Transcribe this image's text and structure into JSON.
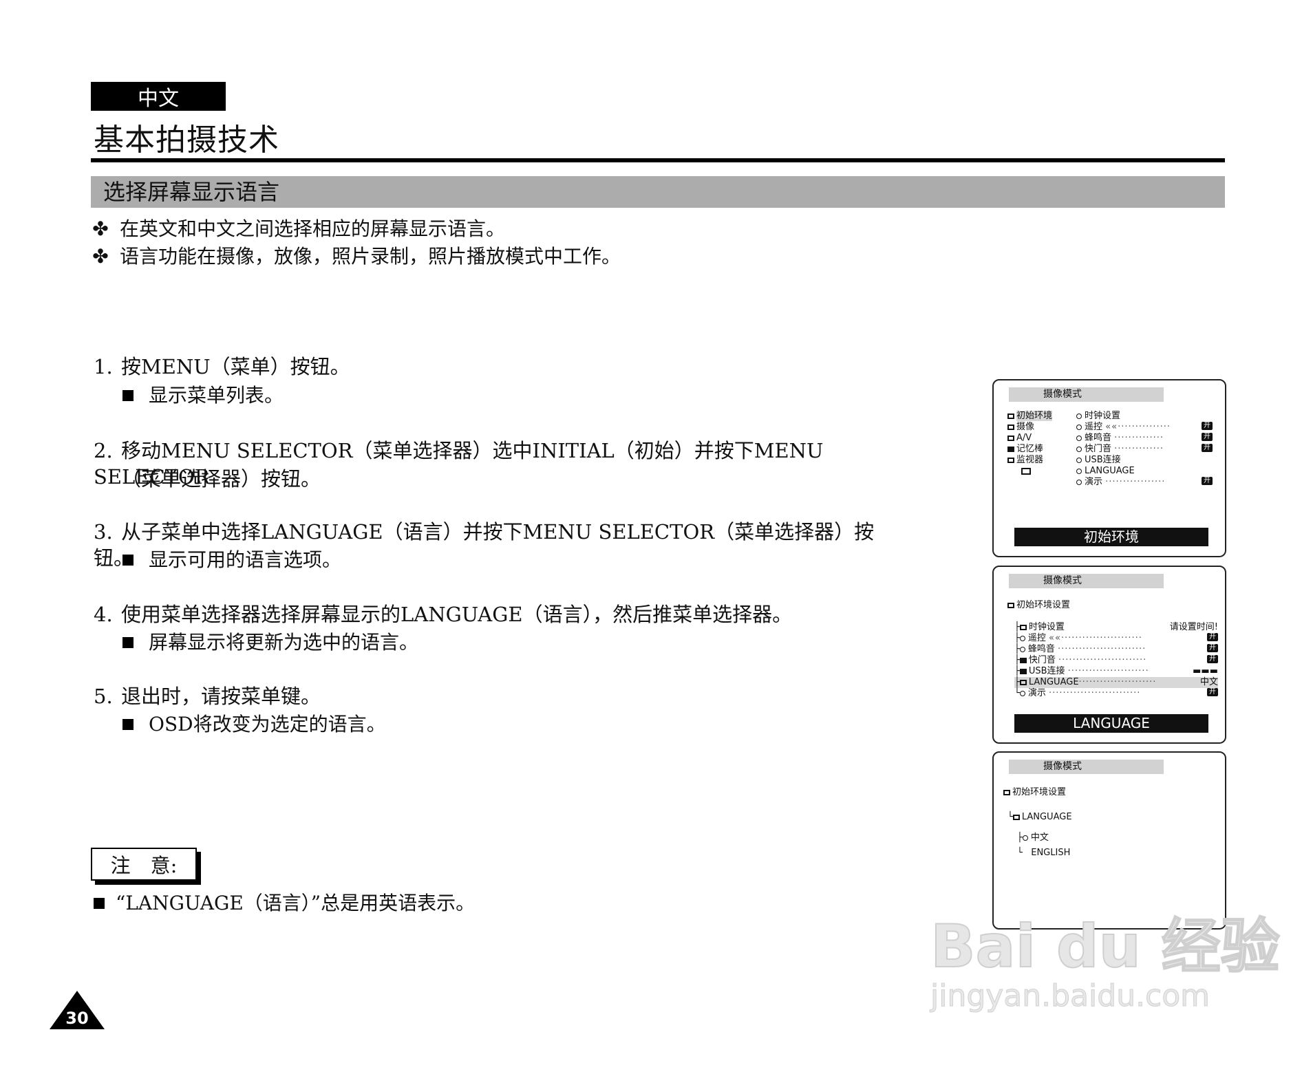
{
  "header": {
    "language_tab": "中文",
    "main_title": "基本拍摄技术",
    "section_title": "选择屏幕显示语言"
  },
  "intro": [
    {
      "mark": "✤",
      "text": "在英文和中文之间选择相应的屏幕显示语言。"
    },
    {
      "mark": "✤",
      "text": "语言功能在摄像，放像，照片录制，照片播放模式中工作。"
    }
  ],
  "steps": [
    {
      "num": "1.",
      "text": "按MENU（菜单）按钮。",
      "sub": "显示菜单列表。"
    },
    {
      "num": "2.",
      "text": "移动MENU SELECTOR（菜单选择器）选中INITIAL（初始）并按下MENU SELECTOR",
      "cont": "（菜单选择器）按钮。"
    },
    {
      "num": "3.",
      "text": "从子菜单中选择LANGUAGE（语言）并按下MENU SELECTOR（菜单选择器）按钮。",
      "sub": "显示可用的语言选项。"
    },
    {
      "num": "4.",
      "text": "使用菜单选择器选择屏幕显示的LANGUAGE（语言），然后推菜单选择器。",
      "sub": "屏幕显示将更新为选中的语言。"
    },
    {
      "num": "5.",
      "text": "退出时，请按菜单键。",
      "sub": "OSD将改变为选定的语言。"
    }
  ],
  "note": {
    "label": "注　意:",
    "text": "“LANGUAGE（语言）”总是用英语表示。"
  },
  "page_number": "30",
  "panel1": {
    "title": "摄像模式",
    "left_menu": [
      "初始环境",
      "摄像",
      "A/V",
      "记忆棒",
      "监视器"
    ],
    "right_menu": [
      {
        "label": "时钟设置",
        "badge": ""
      },
      {
        "label": "遥控",
        "badge": "开"
      },
      {
        "label": "蜂鸣音",
        "badge": "开"
      },
      {
        "label": "快门音",
        "badge": "开"
      },
      {
        "label": "USB连接",
        "badge": ""
      },
      {
        "label": "LANGUAGE",
        "badge": ""
      },
      {
        "label": "演示",
        "badge": "开"
      }
    ],
    "bottom_bar": "初始环境"
  },
  "panel2": {
    "title": "摄像模式",
    "heading": "初始环境设置",
    "items": [
      {
        "label": "时钟设置",
        "value": "请设置时间!"
      },
      {
        "label": "遥控",
        "value": "开"
      },
      {
        "label": "蜂鸣音",
        "value": "开"
      },
      {
        "label": "快门音",
        "value": "开"
      },
      {
        "label": "USB连接",
        "value": "▬▬▬"
      },
      {
        "label": "LANGUAGE",
        "value": "中文"
      },
      {
        "label": "演示",
        "value": "开"
      }
    ],
    "bottom_bar": "LANGUAGE"
  },
  "panel3": {
    "title": "摄像模式",
    "heading": "初始环境设置",
    "sub_heading": "LANGUAGE",
    "options": [
      "中文",
      "ENGLISH"
    ]
  },
  "watermark": {
    "logo": "Bai du 经验",
    "url": "jingyan.baidu.com"
  }
}
